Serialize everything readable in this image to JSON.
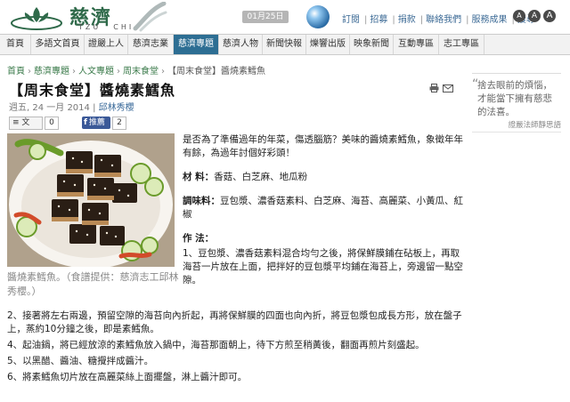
{
  "header": {
    "logo_cn": "慈濟",
    "logo_en_left": "TZU",
    "logo_en_right": "CHI",
    "date": "01月25日",
    "top_links": [
      "訂閱",
      "招募",
      "捐款",
      "聯絡我們",
      "服務成果",
      "搜尋"
    ],
    "round_buttons": [
      "A",
      "A",
      "A"
    ]
  },
  "nav": {
    "items": [
      "首頁",
      "多語文首頁",
      "證嚴上人",
      "慈濟志業",
      "慈濟專題",
      "慈濟人物",
      "新聞快報",
      "爍響出版",
      "映象新聞",
      "互動專區",
      "志工專區"
    ],
    "active_index": 4
  },
  "breadcrumb": [
    "首頁",
    "慈濟專題",
    "人文專題",
    "周末食堂"
  ],
  "breadcrumb_current": "【周末食堂】醬燒素鱈魚",
  "article": {
    "title": "【周末食堂】醬燒素鱈魚",
    "date": "週五, 24 一月 2014",
    "author_sep": " | ",
    "author": "邱林秀櫻",
    "share": {
      "text_btn": "文",
      "text_count": "0",
      "push_btn": "推薦",
      "push_count": "2"
    },
    "image_caption": "醬燒素鱈魚。（食譜提供：慈濟志工邱林秀櫻。）",
    "intro": "是否為了準備過年的年菜，傷透腦筋？美味的醬燒素鱈魚，象徵年年有餘，為過年討個好彩頭！",
    "materials_label": "材 料：",
    "materials": "香菇、白芝麻、地瓜粉",
    "seasoning_label": "調味料：",
    "seasoning": "豆包漿、濃香菇素料、白芝麻、海苔、高麗菜、小黃瓜、紅椒",
    "method_label": "作 法：",
    "step1": "1、豆包漿、濃香菇素料混合均勻之後，將保鮮膜鋪在砧板上，再取海苔一片放在上面，把拌好的豆包漿平均鋪在海苔上，旁邊留一點空隙。",
    "steps": [
      "2、接著將左右兩邊，預留空隙的海苔向內折起，再將保鮮膜的四面也向內折，將豆包漿包成長方形，放在盤子上，蒸約10分鐘之後，即是素鱈魚。",
      "4、起油鍋，將已經放涼的素鱈魚放入鍋中，海苔那面朝上，待下方煎至稍黃後，翻面再煎片刻盛起。",
      "5、以黑醋、醬油、糖攪拌成醬汁。",
      "6、將素鱈魚切片放在高麗菜絲上面擺盤，淋上醬汁即可。"
    ]
  },
  "sidebar": {
    "quote": "捨去眼前的煩惱，才能當下擁有慈悲的法喜。",
    "quote_source": "證嚴法師靜思語"
  },
  "colors": {
    "nav_active": "#2d6e93",
    "link_green": "#3a7a4a",
    "link_blue": "#3d6b96",
    "push_blue": "#3b5998"
  }
}
